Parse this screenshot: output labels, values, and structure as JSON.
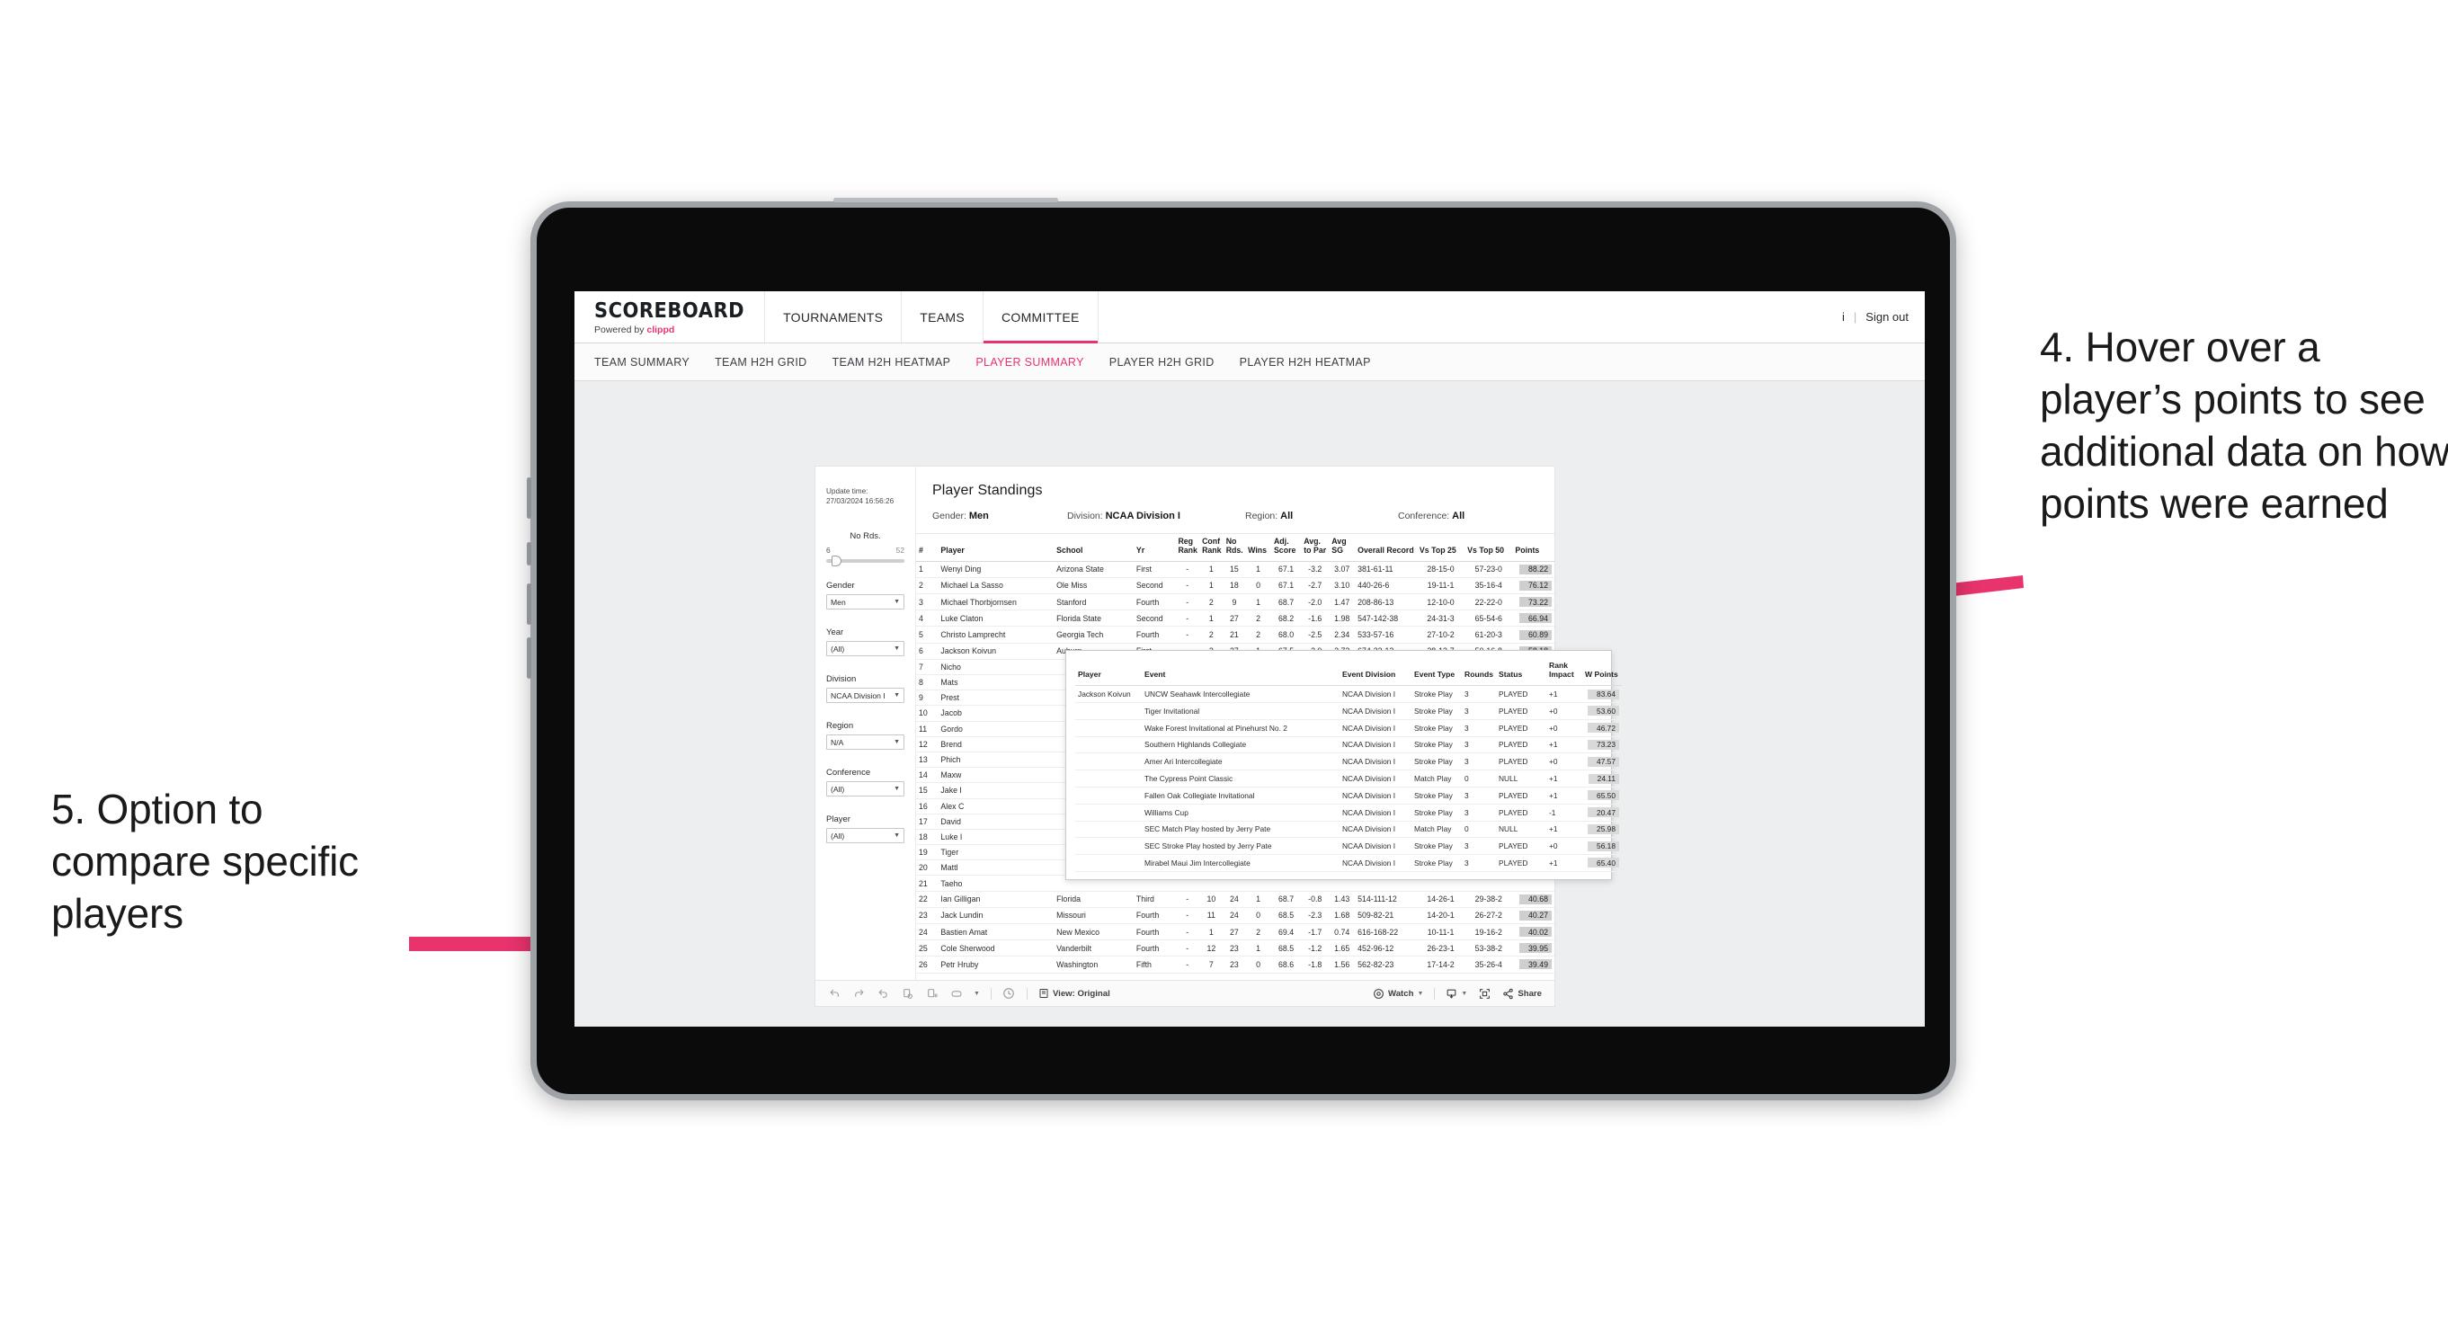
{
  "annotations": {
    "right": "4. Hover over a player’s points to see additional data on how points were earned",
    "left": "5. Option to compare specific players",
    "accent_color": "#e8336d"
  },
  "header": {
    "brand_title": "SCOREBOARD",
    "brand_sub_prefix": "Powered by",
    "brand_sub_name": "clippd",
    "nav": [
      {
        "label": "TOURNAMENTS",
        "active": false
      },
      {
        "label": "TEAMS",
        "active": false
      },
      {
        "label": "COMMITTEE",
        "active": true
      }
    ],
    "user_initial": "i",
    "divider": "|",
    "sign_out": "Sign out"
  },
  "subnav": {
    "items": [
      {
        "label": "TEAM SUMMARY",
        "active": false
      },
      {
        "label": "TEAM H2H GRID",
        "active": false
      },
      {
        "label": "TEAM H2H HEATMAP",
        "active": false
      },
      {
        "label": "PLAYER SUMMARY",
        "active": true
      },
      {
        "label": "PLAYER H2H GRID",
        "active": false
      },
      {
        "label": "PLAYER H2H HEATMAP",
        "active": false
      }
    ]
  },
  "filters": {
    "update_time_label": "Update time:",
    "update_time_value": "27/03/2024 16:56:26",
    "slider": {
      "title": "No Rds.",
      "min": "6",
      "max": "52"
    },
    "controls": [
      {
        "label": "Gender",
        "value": "Men"
      },
      {
        "label": "Year",
        "value": "(All)"
      },
      {
        "label": "Division",
        "value": "NCAA Division I"
      },
      {
        "label": "Region",
        "value": "N/A"
      },
      {
        "label": "Conference",
        "value": "(All)"
      },
      {
        "label": "Player",
        "value": "(All)"
      }
    ]
  },
  "viz": {
    "title": "Player Standings",
    "meta": [
      {
        "label": "Gender:",
        "value": "Men"
      },
      {
        "label": "Division:",
        "value": "NCAA Division I"
      },
      {
        "label": "Region:",
        "value": "All"
      },
      {
        "label": "Conference:",
        "value": "All"
      }
    ],
    "columns": [
      "#",
      "Player",
      "School",
      "Yr",
      "Reg Rank",
      "Conf Rank",
      "No Rds.",
      "Wins",
      "Adj. Score",
      "Avg. to Par",
      "Avg SG",
      "Overall Record",
      "Vs Top 25",
      "Vs Top 50",
      "Points"
    ],
    "rows": [
      {
        "rank": "1",
        "player": "Wenyi Ding",
        "school": "Arizona State",
        "yr": "First",
        "reg": "-",
        "conf": "1",
        "rds": "15",
        "wins": "1",
        "adj": "67.1",
        "par": "-3.2",
        "sg": "3.07",
        "record": "381-61-11",
        "t25": "28-15-0",
        "t50": "57-23-0",
        "points": "88.22"
      },
      {
        "rank": "2",
        "player": "Michael La Sasso",
        "school": "Ole Miss",
        "yr": "Second",
        "reg": "-",
        "conf": "1",
        "rds": "18",
        "wins": "0",
        "adj": "67.1",
        "par": "-2.7",
        "sg": "3.10",
        "record": "440-26-6",
        "t25": "19-11-1",
        "t50": "35-16-4",
        "points": "76.12"
      },
      {
        "rank": "3",
        "player": "Michael Thorbjornsen",
        "school": "Stanford",
        "yr": "Fourth",
        "reg": "-",
        "conf": "2",
        "rds": "9",
        "wins": "1",
        "adj": "68.7",
        "par": "-2.0",
        "sg": "1.47",
        "record": "208-86-13",
        "t25": "12-10-0",
        "t50": "22-22-0",
        "points": "73.22"
      },
      {
        "rank": "4",
        "player": "Luke Claton",
        "school": "Florida State",
        "yr": "Second",
        "reg": "-",
        "conf": "1",
        "rds": "27",
        "wins": "2",
        "adj": "68.2",
        "par": "-1.6",
        "sg": "1.98",
        "record": "547-142-38",
        "t25": "24-31-3",
        "t50": "65-54-6",
        "points": "66.94"
      },
      {
        "rank": "5",
        "player": "Christo Lamprecht",
        "school": "Georgia Tech",
        "yr": "Fourth",
        "reg": "-",
        "conf": "2",
        "rds": "21",
        "wins": "2",
        "adj": "68.0",
        "par": "-2.5",
        "sg": "2.34",
        "record": "533-57-16",
        "t25": "27-10-2",
        "t50": "61-20-3",
        "points": "60.89"
      },
      {
        "rank": "6",
        "player": "Jackson Koivun",
        "school": "Auburn",
        "yr": "First",
        "reg": "-",
        "conf": "2",
        "rds": "27",
        "wins": "1",
        "adj": "67.5",
        "par": "-2.0",
        "sg": "2.72",
        "record": "674-33-12",
        "t25": "28-12-7",
        "t50": "50-16-8",
        "points": "58.18"
      }
    ],
    "obscured_rows": [
      {
        "rank": "7",
        "player": "Nicho"
      },
      {
        "rank": "8",
        "player": "Mats"
      },
      {
        "rank": "9",
        "player": "Prest"
      },
      {
        "rank": "10",
        "player": "Jacob"
      },
      {
        "rank": "11",
        "player": "Gordo"
      },
      {
        "rank": "12",
        "player": "Brend"
      },
      {
        "rank": "13",
        "player": "Phich"
      },
      {
        "rank": "14",
        "player": "Maxw"
      },
      {
        "rank": "15",
        "player": "Jake I"
      },
      {
        "rank": "16",
        "player": "Alex C"
      },
      {
        "rank": "17",
        "player": "David"
      },
      {
        "rank": "18",
        "player": "Luke I"
      },
      {
        "rank": "19",
        "player": "Tiger"
      },
      {
        "rank": "20",
        "player": "Mattl"
      },
      {
        "rank": "21",
        "player": "Taeho"
      }
    ],
    "bottom_rows": [
      {
        "rank": "22",
        "player": "Ian Gilligan",
        "school": "Florida",
        "yr": "Third",
        "reg": "-",
        "conf": "10",
        "rds": "24",
        "wins": "1",
        "adj": "68.7",
        "par": "-0.8",
        "sg": "1.43",
        "record": "514-111-12",
        "t25": "14-26-1",
        "t50": "29-38-2",
        "points": "40.68"
      },
      {
        "rank": "23",
        "player": "Jack Lundin",
        "school": "Missouri",
        "yr": "Fourth",
        "reg": "-",
        "conf": "11",
        "rds": "24",
        "wins": "0",
        "adj": "68.5",
        "par": "-2.3",
        "sg": "1.68",
        "record": "509-82-21",
        "t25": "14-20-1",
        "t50": "26-27-2",
        "points": "40.27"
      },
      {
        "rank": "24",
        "player": "Bastien Amat",
        "school": "New Mexico",
        "yr": "Fourth",
        "reg": "-",
        "conf": "1",
        "rds": "27",
        "wins": "2",
        "adj": "69.4",
        "par": "-1.7",
        "sg": "0.74",
        "record": "616-168-22",
        "t25": "10-11-1",
        "t50": "19-16-2",
        "points": "40.02"
      },
      {
        "rank": "25",
        "player": "Cole Sherwood",
        "school": "Vanderbilt",
        "yr": "Fourth",
        "reg": "-",
        "conf": "12",
        "rds": "23",
        "wins": "1",
        "adj": "68.5",
        "par": "-1.2",
        "sg": "1.65",
        "record": "452-96-12",
        "t25": "26-23-1",
        "t50": "53-38-2",
        "points": "39.95"
      },
      {
        "rank": "26",
        "player": "Petr Hruby",
        "school": "Washington",
        "yr": "Fifth",
        "reg": "-",
        "conf": "7",
        "rds": "23",
        "wins": "0",
        "adj": "68.6",
        "par": "-1.8",
        "sg": "1.56",
        "record": "562-82-23",
        "t25": "17-14-2",
        "t50": "35-26-4",
        "points": "39.49"
      }
    ]
  },
  "tooltip": {
    "columns": [
      "Player",
      "Event",
      "Event Division",
      "Event Type",
      "Rounds",
      "Status",
      "Rank Impact",
      "W Points"
    ],
    "player": "Jackson Koivun",
    "rows": [
      {
        "event": "UNCW Seahawk Intercollegiate",
        "division": "NCAA Division I",
        "type": "Stroke Play",
        "rounds": "3",
        "status": "PLAYED",
        "impact": "+1",
        "wpoints": "83.64"
      },
      {
        "event": "Tiger Invitational",
        "division": "NCAA Division I",
        "type": "Stroke Play",
        "rounds": "3",
        "status": "PLAYED",
        "impact": "+0",
        "wpoints": "53.60"
      },
      {
        "event": "Wake Forest Invitational at Pinehurst No. 2",
        "division": "NCAA Division I",
        "type": "Stroke Play",
        "rounds": "3",
        "status": "PLAYED",
        "impact": "+0",
        "wpoints": "46.72"
      },
      {
        "event": "Southern Highlands Collegiate",
        "division": "NCAA Division I",
        "type": "Stroke Play",
        "rounds": "3",
        "status": "PLAYED",
        "impact": "+1",
        "wpoints": "73.23"
      },
      {
        "event": "Amer Ari Intercollegiate",
        "division": "NCAA Division I",
        "type": "Stroke Play",
        "rounds": "3",
        "status": "PLAYED",
        "impact": "+0",
        "wpoints": "47.57"
      },
      {
        "event": "The Cypress Point Classic",
        "division": "NCAA Division I",
        "type": "Match Play",
        "rounds": "0",
        "status": "NULL",
        "impact": "+1",
        "wpoints": "24.11"
      },
      {
        "event": "Fallen Oak Collegiate Invitational",
        "division": "NCAA Division I",
        "type": "Stroke Play",
        "rounds": "3",
        "status": "PLAYED",
        "impact": "+1",
        "wpoints": "65.50"
      },
      {
        "event": "Williams Cup",
        "division": "NCAA Division I",
        "type": "Stroke Play",
        "rounds": "3",
        "status": "PLAYED",
        "impact": "-1",
        "wpoints": "20.47"
      },
      {
        "event": "SEC Match Play hosted by Jerry Pate",
        "division": "NCAA Division I",
        "type": "Match Play",
        "rounds": "0",
        "status": "NULL",
        "impact": "+1",
        "wpoints": "25.98"
      },
      {
        "event": "SEC Stroke Play hosted by Jerry Pate",
        "division": "NCAA Division I",
        "type": "Stroke Play",
        "rounds": "3",
        "status": "PLAYED",
        "impact": "+0",
        "wpoints": "56.18"
      },
      {
        "event": "Mirabel Maui Jim Intercollegiate",
        "division": "NCAA Division I",
        "type": "Stroke Play",
        "rounds": "3",
        "status": "PLAYED",
        "impact": "+1",
        "wpoints": "65.40"
      }
    ]
  },
  "toolbar": {
    "view_label": "View: Original",
    "watch_label": "Watch",
    "share_label": "Share"
  }
}
